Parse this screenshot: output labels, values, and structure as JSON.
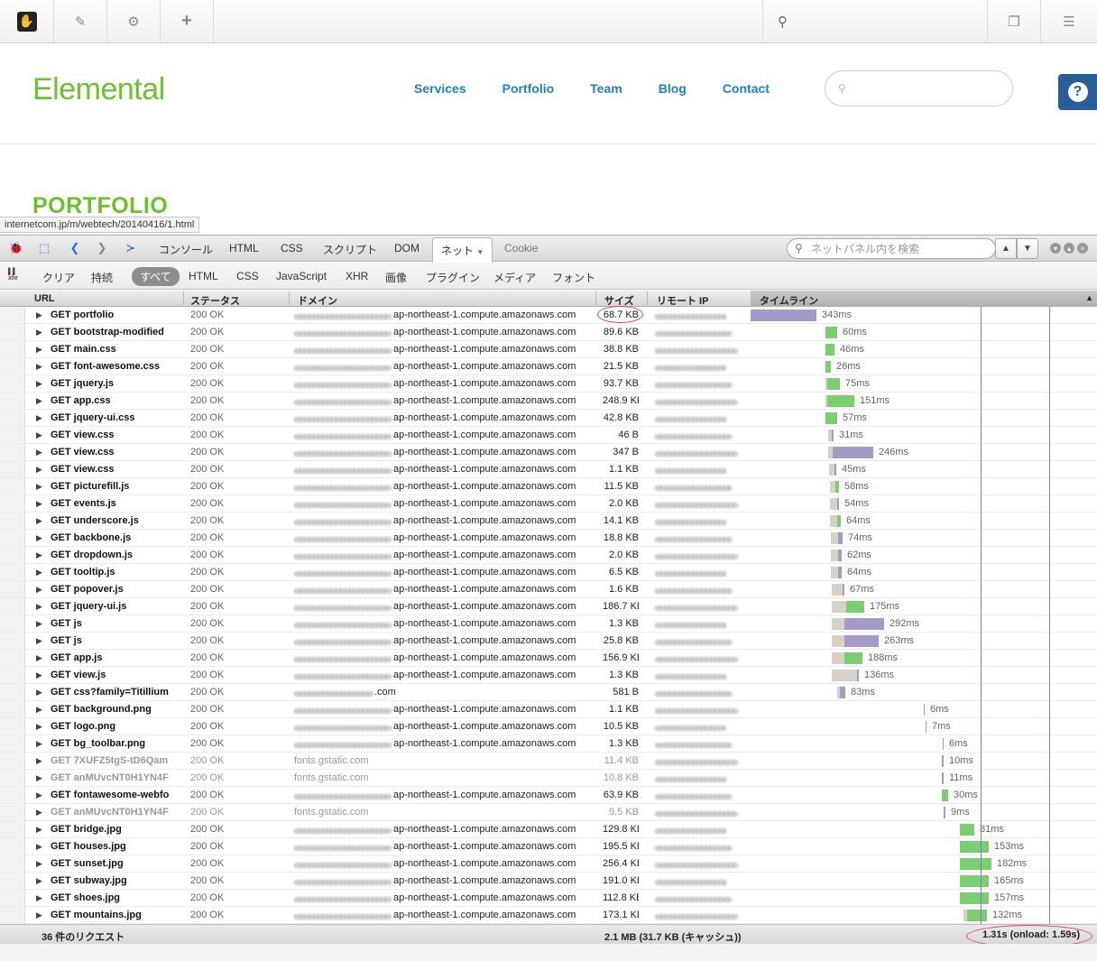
{
  "cms_toolbar": {
    "icons": [
      "concrete5-logo-icon",
      "pencil-icon",
      "gear-icon",
      "plus-icon",
      "search-icon",
      "pages-icon",
      "sliders-icon"
    ]
  },
  "site": {
    "logo": "Elemental",
    "nav": [
      "Services",
      "Portfolio",
      "Team",
      "Blog",
      "Contact"
    ],
    "heading": "PORTFOLIO",
    "help_label": "?"
  },
  "status_url": "internetcom.jp/m/webtech/20140416/1.html",
  "firebug": {
    "tabs": [
      "コンソール",
      "HTML",
      "CSS",
      "スクリプト",
      "DOM",
      "ネット",
      "Cookie"
    ],
    "active_tab": "ネット",
    "search_placeholder": "ネットパネル内を検索",
    "filters": [
      "クリア",
      "持続",
      "すべて",
      "HTML",
      "CSS",
      "JavaScript",
      "XHR",
      "画像",
      "プラグイン",
      "メディア",
      "フォント"
    ],
    "active_filter": "すべて",
    "columns": {
      "url": "URL",
      "status": "ステータス",
      "domain": "ドメイン",
      "size": "サイズ",
      "remote_ip": "リモート IP",
      "timeline": "タイムライン"
    },
    "domain_suffix": "ap-northeast-1.compute.amazonaws.com",
    "requests": [
      {
        "url": "GET portfolio",
        "status": "200 OK",
        "domain": "ap-northeast-1.compute.amazonaws.com",
        "size": "68.7 KB",
        "time": "343ms",
        "start": 0,
        "waitw": 0,
        "recvw": 73,
        "color": "purple",
        "circled": true
      },
      {
        "url": "GET bootstrap-modified",
        "status": "200 OK",
        "domain": "ap-northeast-1.compute.amazonaws.com",
        "size": "89.6 KB",
        "time": "60ms",
        "start": 83,
        "waitw": 0,
        "recvw": 13,
        "color": "green"
      },
      {
        "url": "GET main.css",
        "status": "200 OK",
        "domain": "ap-northeast-1.compute.amazonaws.com",
        "size": "38.8 KB",
        "time": "46ms",
        "start": 83,
        "waitw": 0,
        "recvw": 10,
        "color": "green"
      },
      {
        "url": "GET font-awesome.css",
        "status": "200 OK",
        "domain": "ap-northeast-1.compute.amazonaws.com",
        "size": "21.5 KB",
        "time": "26ms",
        "start": 83,
        "waitw": 0,
        "recvw": 6,
        "color": "green"
      },
      {
        "url": "GET jquery.js",
        "status": "200 OK",
        "domain": "ap-northeast-1.compute.amazonaws.com",
        "size": "93.7 KB",
        "time": "75ms",
        "start": 83,
        "waitw": 2,
        "recvw": 14,
        "color": "green"
      },
      {
        "url": "GET app.css",
        "status": "200 OK",
        "domain": "ap-northeast-1.compute.amazonaws.com",
        "size": "248.9 KB",
        "time": "151ms",
        "start": 83,
        "waitw": 2,
        "recvw": 30,
        "color": "green"
      },
      {
        "url": "GET jquery-ui.css",
        "status": "200 OK",
        "domain": "ap-northeast-1.compute.amazonaws.com",
        "size": "42.8 KB",
        "time": "57ms",
        "start": 83,
        "waitw": 0,
        "recvw": 13,
        "color": "green"
      },
      {
        "url": "GET view.css",
        "status": "200 OK",
        "domain": "ap-northeast-1.compute.amazonaws.com",
        "size": "46 B",
        "time": "31ms",
        "start": 86,
        "waitw": 4,
        "recvw": 2,
        "color": "purple"
      },
      {
        "url": "GET view.css",
        "status": "200 OK",
        "domain": "ap-northeast-1.compute.amazonaws.com",
        "size": "347 B",
        "time": "246ms",
        "start": 86,
        "waitw": 5,
        "recvw": 45,
        "color": "purple"
      },
      {
        "url": "GET view.css",
        "status": "200 OK",
        "domain": "ap-northeast-1.compute.amazonaws.com",
        "size": "1.1 KB",
        "time": "45ms",
        "start": 87,
        "waitw": 6,
        "recvw": 2,
        "color": "purple"
      },
      {
        "url": "GET picturefill.js",
        "status": "200 OK",
        "domain": "ap-northeast-1.compute.amazonaws.com",
        "size": "11.5 KB",
        "time": "58ms",
        "start": 88,
        "waitw": 6,
        "recvw": 4,
        "color": "green"
      },
      {
        "url": "GET events.js",
        "status": "200 OK",
        "domain": "ap-northeast-1.compute.amazonaws.com",
        "size": "2.0 KB",
        "time": "54ms",
        "start": 88,
        "waitw": 8,
        "recvw": 2,
        "color": "purple"
      },
      {
        "url": "GET underscore.js",
        "status": "200 OK",
        "domain": "ap-northeast-1.compute.amazonaws.com",
        "size": "14.1 KB",
        "time": "64ms",
        "start": 88,
        "waitw": 8,
        "recvw": 4,
        "color": "green"
      },
      {
        "url": "GET backbone.js",
        "status": "200 OK",
        "domain": "ap-northeast-1.compute.amazonaws.com",
        "size": "18.8 KB",
        "time": "74ms",
        "start": 89,
        "waitw": 8,
        "recvw": 5,
        "color": "purple"
      },
      {
        "url": "GET dropdown.js",
        "status": "200 OK",
        "domain": "ap-northeast-1.compute.amazonaws.com",
        "size": "2.0 KB",
        "time": "62ms",
        "start": 89,
        "waitw": 8,
        "recvw": 4,
        "color": "purple"
      },
      {
        "url": "GET tooltip.js",
        "status": "200 OK",
        "domain": "ap-northeast-1.compute.amazonaws.com",
        "size": "6.5 KB",
        "time": "64ms",
        "start": 89,
        "waitw": 8,
        "recvw": 4,
        "color": "purple"
      },
      {
        "url": "GET popover.js",
        "status": "200 OK",
        "domain": "ap-northeast-1.compute.amazonaws.com",
        "size": "1.6 KB",
        "time": "67ms",
        "start": 90,
        "waitw": 12,
        "recvw": 2,
        "color": "purple"
      },
      {
        "url": "GET jquery-ui.js",
        "status": "200 OK",
        "domain": "ap-northeast-1.compute.amazonaws.com",
        "size": "186.7 KB",
        "time": "175ms",
        "start": 90,
        "waitw": 16,
        "recvw": 20,
        "color": "green"
      },
      {
        "url": "GET js",
        "status": "200 OK",
        "domain": "ap-northeast-1.compute.amazonaws.com",
        "size": "1.3 KB",
        "time": "292ms",
        "start": 90,
        "waitw": 14,
        "recvw": 44,
        "color": "purple"
      },
      {
        "url": "GET js",
        "status": "200 OK",
        "domain": "ap-northeast-1.compute.amazonaws.com",
        "size": "25.8 KB",
        "time": "263ms",
        "start": 90,
        "waitw": 14,
        "recvw": 38,
        "color": "purple"
      },
      {
        "url": "GET app.js",
        "status": "200 OK",
        "domain": "ap-northeast-1.compute.amazonaws.com",
        "size": "156.9 KB",
        "time": "188ms",
        "start": 90,
        "waitw": 14,
        "recvw": 20,
        "color": "green"
      },
      {
        "url": "GET view.js",
        "status": "200 OK",
        "domain": "ap-northeast-1.compute.amazonaws.com",
        "size": "1.3 KB",
        "time": "136ms",
        "start": 90,
        "waitw": 28,
        "recvw": 2,
        "color": "purple"
      },
      {
        "url": "GET css?family=Titillium",
        "status": "200 OK",
        "domain": ".com",
        "size": "581 B",
        "time": "83ms",
        "start": 96,
        "waitw": 3,
        "recvw": 6,
        "color": "purple"
      },
      {
        "url": "GET background.png",
        "status": "200 OK",
        "domain": "ap-northeast-1.compute.amazonaws.com",
        "size": "1.1 KB",
        "time": "6ms",
        "start": 192,
        "waitw": 0,
        "recvw": 1,
        "color": "purple"
      },
      {
        "url": "GET logo.png",
        "status": "200 OK",
        "domain": "ap-northeast-1.compute.amazonaws.com",
        "size": "10.5 KB",
        "time": "7ms",
        "start": 194,
        "waitw": 0,
        "recvw": 1,
        "color": "purple"
      },
      {
        "url": "GET bg_toolbar.png",
        "status": "200 OK",
        "domain": "ap-northeast-1.compute.amazonaws.com",
        "size": "1.3 KB",
        "time": "6ms",
        "start": 213,
        "waitw": 0,
        "recvw": 1,
        "color": "purple"
      },
      {
        "url": "GET 7XUFZ5tgS-tD6Qam",
        "status": "200 OK",
        "domain": "fonts.gstatic.com",
        "size": "11.4 KB",
        "time": "10ms",
        "start": 212,
        "waitw": 0,
        "recvw": 2,
        "color": "purple",
        "font": true
      },
      {
        "url": "GET anMUvcNT0H1YN4F",
        "status": "200 OK",
        "domain": "fonts.gstatic.com",
        "size": "10.8 KB",
        "time": "11ms",
        "start": 212,
        "waitw": 0,
        "recvw": 2,
        "color": "purple",
        "font": true
      },
      {
        "url": "GET fontawesome-webfo",
        "status": "200 OK",
        "domain": "ap-northeast-1.compute.amazonaws.com",
        "size": "63.9 KB",
        "time": "30ms",
        "start": 212,
        "waitw": 0,
        "recvw": 7,
        "color": "green"
      },
      {
        "url": "GET anMUvcNT0H1YN4F",
        "status": "200 OK",
        "domain": "fonts.gstatic.com",
        "size": "9.5 KB",
        "time": "9ms",
        "start": 214,
        "waitw": 0,
        "recvw": 2,
        "color": "purple",
        "font": true
      },
      {
        "url": "GET bridge.jpg",
        "status": "200 OK",
        "domain": "ap-northeast-1.compute.amazonaws.com",
        "size": "129.8 KB",
        "time": "81ms",
        "start": 232,
        "waitw": 0,
        "recvw": 16,
        "color": "green"
      },
      {
        "url": "GET houses.jpg",
        "status": "200 OK",
        "domain": "ap-northeast-1.compute.amazonaws.com",
        "size": "195.5 KB",
        "time": "153ms",
        "start": 232,
        "waitw": 0,
        "recvw": 32,
        "color": "green"
      },
      {
        "url": "GET sunset.jpg",
        "status": "200 OK",
        "domain": "ap-northeast-1.compute.amazonaws.com",
        "size": "256.4 KB",
        "time": "182ms",
        "start": 232,
        "waitw": 0,
        "recvw": 35,
        "color": "green"
      },
      {
        "url": "GET subway.jpg",
        "status": "200 OK",
        "domain": "ap-northeast-1.compute.amazonaws.com",
        "size": "191.0 KB",
        "time": "165ms",
        "start": 232,
        "waitw": 0,
        "recvw": 32,
        "color": "green"
      },
      {
        "url": "GET shoes.jpg",
        "status": "200 OK",
        "domain": "ap-northeast-1.compute.amazonaws.com",
        "size": "112.8 KB",
        "time": "157ms",
        "start": 232,
        "waitw": 0,
        "recvw": 32,
        "color": "green"
      },
      {
        "url": "GET mountains.jpg",
        "status": "200 OK",
        "domain": "ap-northeast-1.compute.amazonaws.com",
        "size": "173.1 KB",
        "time": "132ms",
        "start": 236,
        "waitw": 4,
        "recvw": 22,
        "color": "green"
      }
    ],
    "footer": {
      "count": "36 件のリクエスト",
      "total": "2.1 MB (31.7 KB (キャッシュ))",
      "timing": "1.31s (onload: 1.59s)"
    },
    "colors": {
      "green": "#7ccf6f",
      "purple": "#a59ac8",
      "wait": "#d8d2c4",
      "domline": "#6f7fd6",
      "onloadline": "#d96c8a",
      "circle": "#e0407a"
    }
  }
}
